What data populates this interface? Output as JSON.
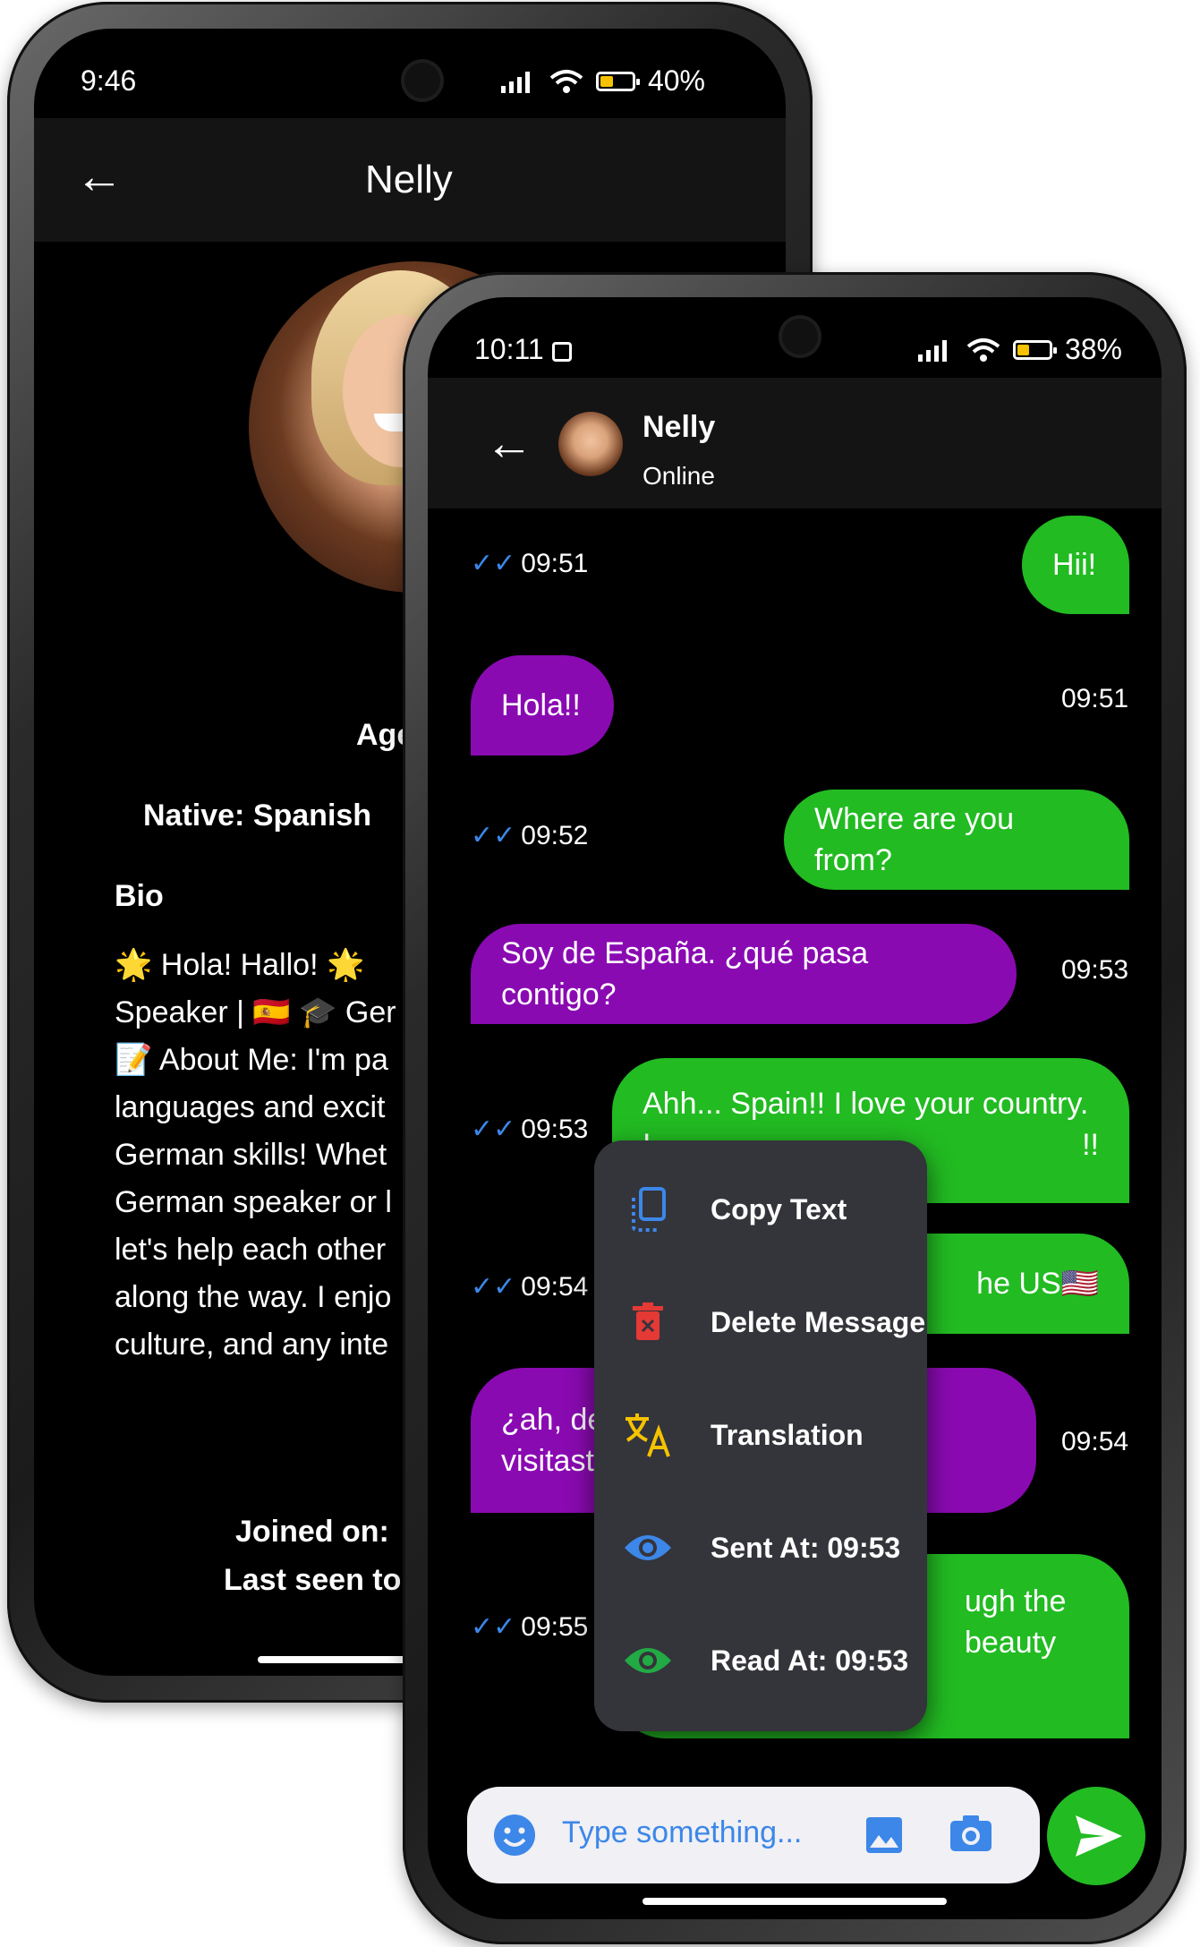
{
  "colors": {
    "outgoing": "#22bb22",
    "incoming": "#8a0ab2",
    "menu": "#34343b",
    "tick": "#3c87e8"
  },
  "back_phone": {
    "status": {
      "time": "9:46",
      "battery": "40%"
    },
    "title": "Nelly",
    "age_label": "Age",
    "native": "Native: Spanish",
    "bio_heading": "Bio",
    "bio_lines": [
      "🌟 Hola! Hallo! 🌟",
      "Speaker | 🇪🇸 🎓 Ger",
      "📝 About Me: I'm pa",
      "languages and excit",
      "German skills! Whet",
      "German speaker or l",
      "let's help each other",
      "along the way. I enjo",
      "culture, and any inte"
    ],
    "joined": "Joined on:",
    "last_seen": "Last seen to"
  },
  "front_phone": {
    "status": {
      "time": "10:11",
      "battery": "38%"
    },
    "contact": {
      "name": "Nelly",
      "presence": "Online"
    },
    "messages": [
      {
        "dir": "out",
        "text": "Hii!",
        "time": "09:51"
      },
      {
        "dir": "in",
        "text": "Hola!!",
        "time": "09:51"
      },
      {
        "dir": "out",
        "text": "Where are you from?",
        "time": "09:52"
      },
      {
        "dir": "in",
        "text": "Soy de España. ¿qué pasa contigo?",
        "time": "09:53"
      },
      {
        "dir": "out",
        "text": "Ahh... Spain!! I love your country.",
        "text2": "I",
        "text3": "!!",
        "time": "09:53"
      },
      {
        "dir": "out",
        "text": "he US🇺🇸",
        "time": "09:54"
      },
      {
        "dir": "in",
        "text": "¿ah, de ver",
        "text2": "visitaste?",
        "time": "09:54"
      },
      {
        "dir": "out",
        "text": "ugh the",
        "text2": "beauty",
        "time": "09:55"
      }
    ],
    "context_menu": [
      {
        "icon": "copy-icon",
        "label": "Copy Text"
      },
      {
        "icon": "delete-icon",
        "label": "Delete Message"
      },
      {
        "icon": "translate-icon",
        "label": "Translation"
      },
      {
        "icon": "eye-icon",
        "label": "Sent At: 09:53"
      },
      {
        "icon": "eye-icon",
        "label": "Read At: 09:53"
      }
    ],
    "input": {
      "placeholder": "Type something..."
    }
  }
}
